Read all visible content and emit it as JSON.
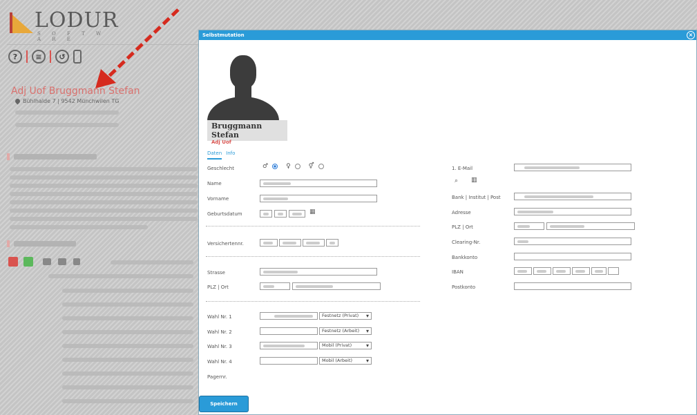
{
  "background": {
    "logo_name": "LODUR",
    "logo_sub": "S O F T W A R E",
    "toolbar_icons": [
      "help-icon",
      "list-icon",
      "history-icon",
      "mobile-icon"
    ],
    "person_name": "Adj Uof Bruggmann Stefan",
    "address": "Bühlhalde 7 | 9542 Münchwilen TG"
  },
  "modal": {
    "title": "Selbstmutation",
    "close_glyph": "×",
    "profile": {
      "name": "Bruggmann Stefan",
      "rank": "Adj Uof"
    },
    "tabs": [
      {
        "label": "Daten",
        "active": true
      },
      {
        "label": "Info",
        "active": false
      }
    ],
    "left": {
      "gender_label": "Geschlecht",
      "gender_options": [
        {
          "symbol": "♂",
          "selected": true
        },
        {
          "symbol": "♀",
          "selected": false
        },
        {
          "symbol": "⚥",
          "selected": false
        }
      ],
      "name_label": "Name",
      "vorname_label": "Vorname",
      "geburtsdatum_label": "Geburtsdatum",
      "versicherten_label": "Versichertennr.",
      "strasse_label": "Strasse",
      "plz_ort_label": "PLZ | Ort",
      "phones": [
        {
          "label": "Wahl Nr. 1",
          "type": "Festnetz (Privat)"
        },
        {
          "label": "Wahl Nr. 2",
          "type": "Festnetz (Arbeit)"
        },
        {
          "label": "Wahl Nr. 3",
          "type": "Mobil (Privat)"
        },
        {
          "label": "Wahl Nr. 4",
          "type": "Mobil (Arbeit)"
        }
      ],
      "pager_label": "Pagernr."
    },
    "right": {
      "email_label": "1. E-Mail",
      "bank_label": "Bank | Institut | Post",
      "adresse_label": "Adresse",
      "plz_ort_label": "PLZ | Ort",
      "clearing_label": "Clearing-Nr.",
      "bankkonto_label": "Bankkonto",
      "iban_label": "IBAN",
      "postkonto_label": "Postkonto"
    },
    "save_label": "Speichern"
  },
  "colors": {
    "accent": "#2a9bd8",
    "red": "#d9534f",
    "logo_orange": "#e8a83a"
  }
}
